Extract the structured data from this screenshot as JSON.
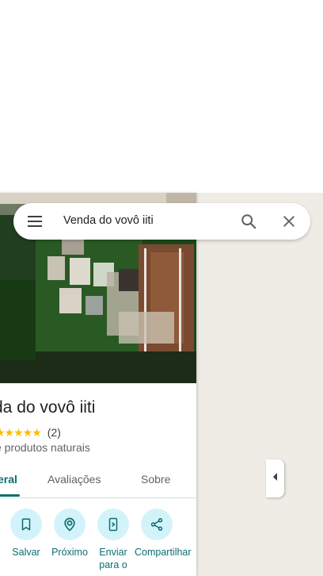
{
  "search": {
    "query": "Venda do vovô iiti",
    "menu_icon": "menu-icon",
    "search_icon": "search-icon",
    "close_icon": "close-icon"
  },
  "place": {
    "title": "da do vovô iiti",
    "rating_stars": "★★★★★",
    "rating_value": 5,
    "reviews_count": "(2)",
    "category": "e produtos naturais"
  },
  "tabs": [
    {
      "label": "eral",
      "active": true
    },
    {
      "label": "Avaliações",
      "active": false
    },
    {
      "label": "Sobre",
      "active": false
    }
  ],
  "actions": [
    {
      "label": "Salvar",
      "icon": "bookmark-icon"
    },
    {
      "label": "Próximo",
      "icon": "nearby-icon"
    },
    {
      "label": "Enviar para o",
      "icon": "send-to-phone-icon"
    },
    {
      "label": "Compartilhar",
      "icon": "share-icon"
    }
  ],
  "map": {
    "collapse_icon": "chevron-left-icon"
  },
  "colors": {
    "accent": "#0b6e70",
    "action_circle": "#d3f3fa",
    "star": "#fbbc04",
    "map_background": "#efece6"
  }
}
